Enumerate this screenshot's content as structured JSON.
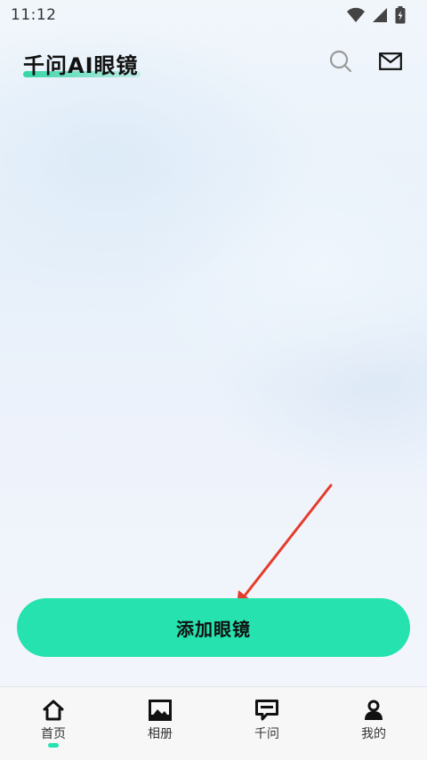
{
  "status_bar": {
    "time": "11:12",
    "icons": [
      "wifi-icon",
      "cellular-signal-icon",
      "battery-charging-icon"
    ]
  },
  "header": {
    "title": "千问AI眼镜",
    "icons": [
      "search-icon",
      "mail-icon"
    ]
  },
  "main": {
    "add_button_label": "添加眼镜"
  },
  "annotation": {
    "arrow_color": "#e53b2c"
  },
  "bottom_nav": {
    "items": [
      {
        "label": "首页",
        "icon": "home-icon",
        "active": true
      },
      {
        "label": "相册",
        "icon": "album-icon",
        "active": false
      },
      {
        "label": "千问",
        "icon": "chat-icon",
        "active": false
      },
      {
        "label": "我的",
        "icon": "profile-icon",
        "active": false
      }
    ]
  },
  "colors": {
    "accent": "#26e2af",
    "text": "#111111",
    "nav_background": "#f7f7f8"
  }
}
